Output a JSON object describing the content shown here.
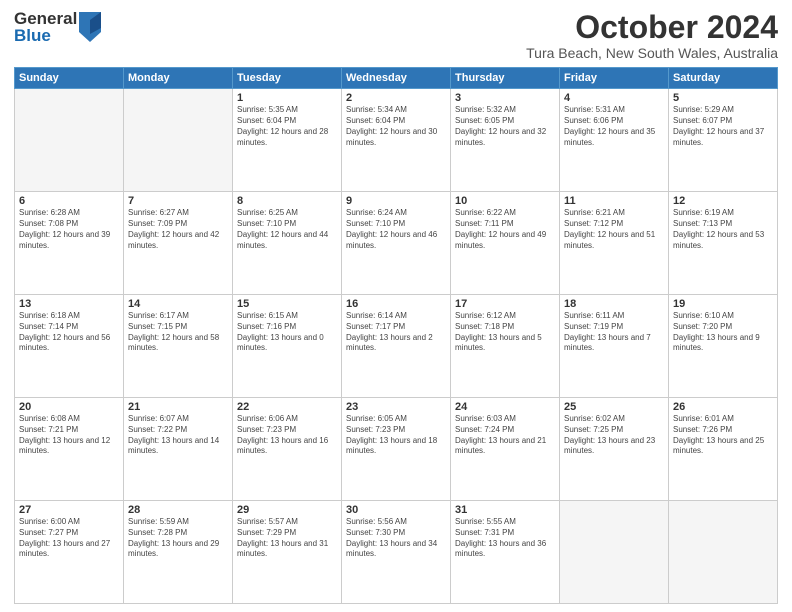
{
  "header": {
    "logo_general": "General",
    "logo_blue": "Blue",
    "month_title": "October 2024",
    "location": "Tura Beach, New South Wales, Australia"
  },
  "days_of_week": [
    "Sunday",
    "Monday",
    "Tuesday",
    "Wednesday",
    "Thursday",
    "Friday",
    "Saturday"
  ],
  "weeks": [
    [
      {
        "day": "",
        "sunrise": "",
        "sunset": "",
        "daylight": "",
        "empty": true
      },
      {
        "day": "",
        "sunrise": "",
        "sunset": "",
        "daylight": "",
        "empty": true
      },
      {
        "day": "1",
        "sunrise": "Sunrise: 5:35 AM",
        "sunset": "Sunset: 6:04 PM",
        "daylight": "Daylight: 12 hours and 28 minutes.",
        "empty": false
      },
      {
        "day": "2",
        "sunrise": "Sunrise: 5:34 AM",
        "sunset": "Sunset: 6:04 PM",
        "daylight": "Daylight: 12 hours and 30 minutes.",
        "empty": false
      },
      {
        "day": "3",
        "sunrise": "Sunrise: 5:32 AM",
        "sunset": "Sunset: 6:05 PM",
        "daylight": "Daylight: 12 hours and 32 minutes.",
        "empty": false
      },
      {
        "day": "4",
        "sunrise": "Sunrise: 5:31 AM",
        "sunset": "Sunset: 6:06 PM",
        "daylight": "Daylight: 12 hours and 35 minutes.",
        "empty": false
      },
      {
        "day": "5",
        "sunrise": "Sunrise: 5:29 AM",
        "sunset": "Sunset: 6:07 PM",
        "daylight": "Daylight: 12 hours and 37 minutes.",
        "empty": false
      }
    ],
    [
      {
        "day": "6",
        "sunrise": "Sunrise: 6:28 AM",
        "sunset": "Sunset: 7:08 PM",
        "daylight": "Daylight: 12 hours and 39 minutes.",
        "empty": false
      },
      {
        "day": "7",
        "sunrise": "Sunrise: 6:27 AM",
        "sunset": "Sunset: 7:09 PM",
        "daylight": "Daylight: 12 hours and 42 minutes.",
        "empty": false
      },
      {
        "day": "8",
        "sunrise": "Sunrise: 6:25 AM",
        "sunset": "Sunset: 7:10 PM",
        "daylight": "Daylight: 12 hours and 44 minutes.",
        "empty": false
      },
      {
        "day": "9",
        "sunrise": "Sunrise: 6:24 AM",
        "sunset": "Sunset: 7:10 PM",
        "daylight": "Daylight: 12 hours and 46 minutes.",
        "empty": false
      },
      {
        "day": "10",
        "sunrise": "Sunrise: 6:22 AM",
        "sunset": "Sunset: 7:11 PM",
        "daylight": "Daylight: 12 hours and 49 minutes.",
        "empty": false
      },
      {
        "day": "11",
        "sunrise": "Sunrise: 6:21 AM",
        "sunset": "Sunset: 7:12 PM",
        "daylight": "Daylight: 12 hours and 51 minutes.",
        "empty": false
      },
      {
        "day": "12",
        "sunrise": "Sunrise: 6:19 AM",
        "sunset": "Sunset: 7:13 PM",
        "daylight": "Daylight: 12 hours and 53 minutes.",
        "empty": false
      }
    ],
    [
      {
        "day": "13",
        "sunrise": "Sunrise: 6:18 AM",
        "sunset": "Sunset: 7:14 PM",
        "daylight": "Daylight: 12 hours and 56 minutes.",
        "empty": false
      },
      {
        "day": "14",
        "sunrise": "Sunrise: 6:17 AM",
        "sunset": "Sunset: 7:15 PM",
        "daylight": "Daylight: 12 hours and 58 minutes.",
        "empty": false
      },
      {
        "day": "15",
        "sunrise": "Sunrise: 6:15 AM",
        "sunset": "Sunset: 7:16 PM",
        "daylight": "Daylight: 13 hours and 0 minutes.",
        "empty": false
      },
      {
        "day": "16",
        "sunrise": "Sunrise: 6:14 AM",
        "sunset": "Sunset: 7:17 PM",
        "daylight": "Daylight: 13 hours and 2 minutes.",
        "empty": false
      },
      {
        "day": "17",
        "sunrise": "Sunrise: 6:12 AM",
        "sunset": "Sunset: 7:18 PM",
        "daylight": "Daylight: 13 hours and 5 minutes.",
        "empty": false
      },
      {
        "day": "18",
        "sunrise": "Sunrise: 6:11 AM",
        "sunset": "Sunset: 7:19 PM",
        "daylight": "Daylight: 13 hours and 7 minutes.",
        "empty": false
      },
      {
        "day": "19",
        "sunrise": "Sunrise: 6:10 AM",
        "sunset": "Sunset: 7:20 PM",
        "daylight": "Daylight: 13 hours and 9 minutes.",
        "empty": false
      }
    ],
    [
      {
        "day": "20",
        "sunrise": "Sunrise: 6:08 AM",
        "sunset": "Sunset: 7:21 PM",
        "daylight": "Daylight: 13 hours and 12 minutes.",
        "empty": false
      },
      {
        "day": "21",
        "sunrise": "Sunrise: 6:07 AM",
        "sunset": "Sunset: 7:22 PM",
        "daylight": "Daylight: 13 hours and 14 minutes.",
        "empty": false
      },
      {
        "day": "22",
        "sunrise": "Sunrise: 6:06 AM",
        "sunset": "Sunset: 7:23 PM",
        "daylight": "Daylight: 13 hours and 16 minutes.",
        "empty": false
      },
      {
        "day": "23",
        "sunrise": "Sunrise: 6:05 AM",
        "sunset": "Sunset: 7:23 PM",
        "daylight": "Daylight: 13 hours and 18 minutes.",
        "empty": false
      },
      {
        "day": "24",
        "sunrise": "Sunrise: 6:03 AM",
        "sunset": "Sunset: 7:24 PM",
        "daylight": "Daylight: 13 hours and 21 minutes.",
        "empty": false
      },
      {
        "day": "25",
        "sunrise": "Sunrise: 6:02 AM",
        "sunset": "Sunset: 7:25 PM",
        "daylight": "Daylight: 13 hours and 23 minutes.",
        "empty": false
      },
      {
        "day": "26",
        "sunrise": "Sunrise: 6:01 AM",
        "sunset": "Sunset: 7:26 PM",
        "daylight": "Daylight: 13 hours and 25 minutes.",
        "empty": false
      }
    ],
    [
      {
        "day": "27",
        "sunrise": "Sunrise: 6:00 AM",
        "sunset": "Sunset: 7:27 PM",
        "daylight": "Daylight: 13 hours and 27 minutes.",
        "empty": false
      },
      {
        "day": "28",
        "sunrise": "Sunrise: 5:59 AM",
        "sunset": "Sunset: 7:28 PM",
        "daylight": "Daylight: 13 hours and 29 minutes.",
        "empty": false
      },
      {
        "day": "29",
        "sunrise": "Sunrise: 5:57 AM",
        "sunset": "Sunset: 7:29 PM",
        "daylight": "Daylight: 13 hours and 31 minutes.",
        "empty": false
      },
      {
        "day": "30",
        "sunrise": "Sunrise: 5:56 AM",
        "sunset": "Sunset: 7:30 PM",
        "daylight": "Daylight: 13 hours and 34 minutes.",
        "empty": false
      },
      {
        "day": "31",
        "sunrise": "Sunrise: 5:55 AM",
        "sunset": "Sunset: 7:31 PM",
        "daylight": "Daylight: 13 hours and 36 minutes.",
        "empty": false
      },
      {
        "day": "",
        "sunrise": "",
        "sunset": "",
        "daylight": "",
        "empty": true
      },
      {
        "day": "",
        "sunrise": "",
        "sunset": "",
        "daylight": "",
        "empty": true
      }
    ]
  ]
}
